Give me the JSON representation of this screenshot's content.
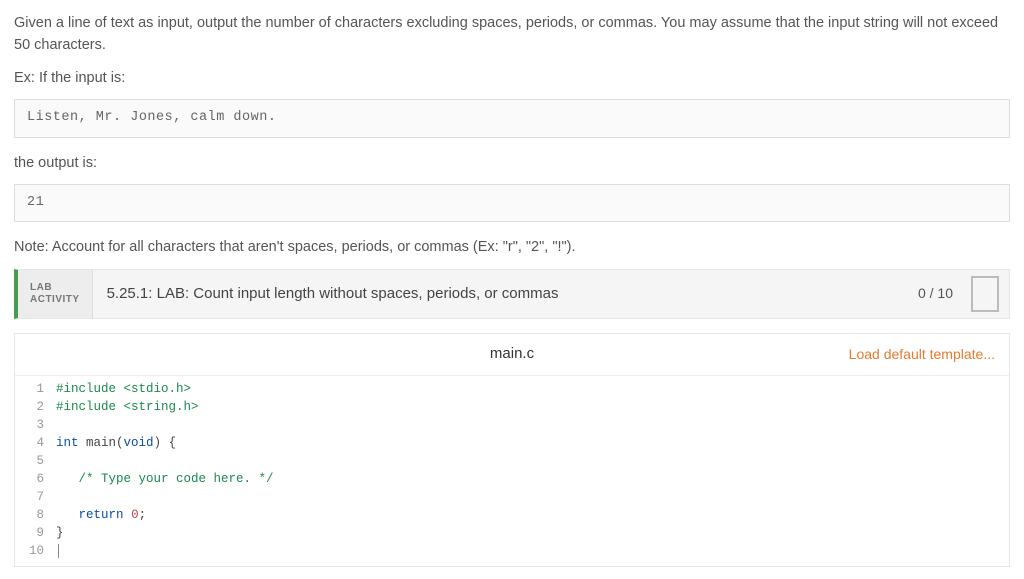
{
  "problem": {
    "p1": "Given a line of text as input, output the number of characters excluding spaces, periods, or commas. You may assume that the input string will not exceed 50 characters.",
    "p2": "Ex: If the input is:",
    "input_example": "Listen, Mr. Jones, calm down.",
    "p3": "the output is:",
    "output_example": "21",
    "p4": "Note: Account for all characters that aren't spaces, periods, or commas (Ex: \"r\", \"2\", \"!\")."
  },
  "lab": {
    "label_top": "LAB",
    "label_bottom": "ACTIVITY",
    "title": "5.25.1: LAB: Count input length without spaces, periods, or commas",
    "score": "0 / 10"
  },
  "editor": {
    "filename": "main.c",
    "load_template": "Load default template...",
    "lines": [
      {
        "n": 1
      },
      {
        "n": 2
      },
      {
        "n": 3
      },
      {
        "n": 4
      },
      {
        "n": 5
      },
      {
        "n": 6
      },
      {
        "n": 7
      },
      {
        "n": 8
      },
      {
        "n": 9
      },
      {
        "n": 10
      }
    ],
    "code": {
      "l1a": "#include ",
      "l1b": "<stdio.h>",
      "l2a": "#include ",
      "l2b": "<string.h>",
      "l4a": "int",
      "l4b": " main(",
      "l4c": "void",
      "l4d": ") {",
      "l6": "   /* Type your code here. */",
      "l8a": "   ",
      "l8b": "return",
      "l8c": " ",
      "l8d": "0",
      "l8e": ";",
      "l9": "}"
    }
  }
}
